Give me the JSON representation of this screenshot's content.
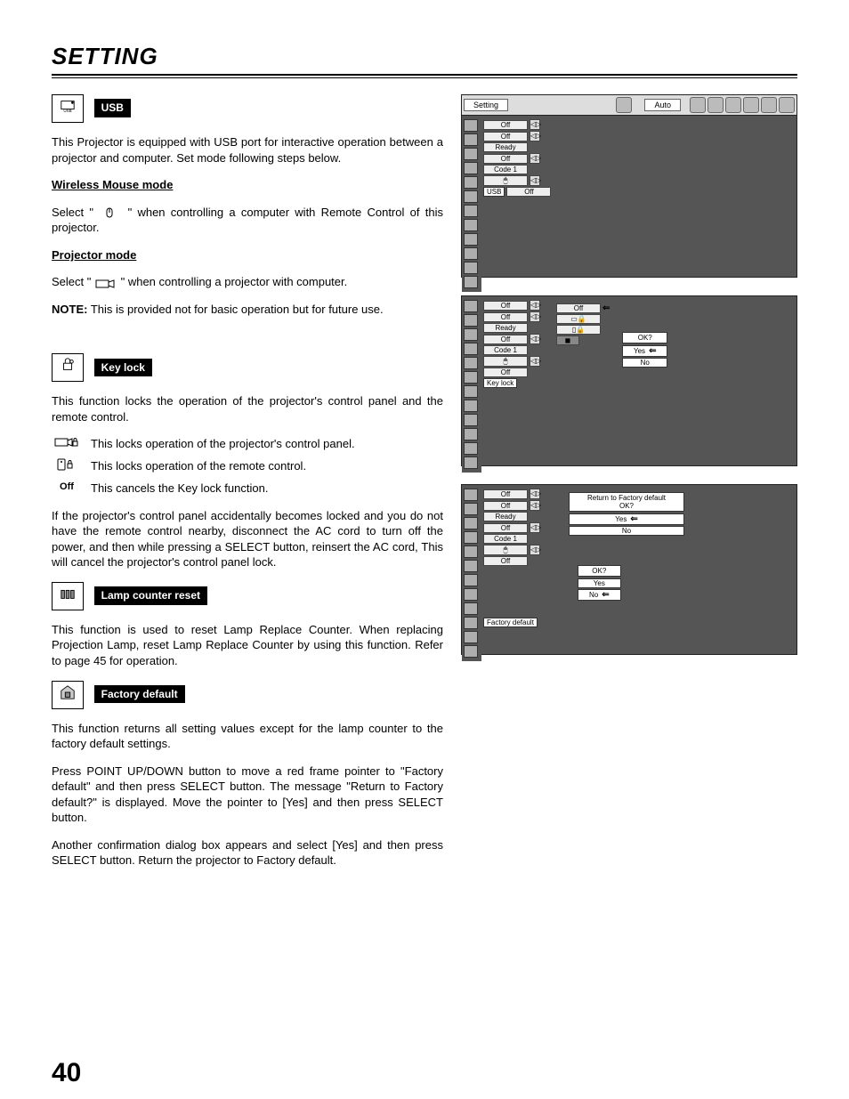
{
  "page_title": "SETTING",
  "page_number": "40",
  "usb": {
    "label": "USB",
    "intro": "This Projector is equipped with USB port for interactive operation between a projector and computer. Set mode following steps below.",
    "wireless_heading": "Wireless Mouse mode",
    "wireless_pre": "Select \"",
    "wireless_post": "\" when controlling a computer with Remote Control of this projector.",
    "projector_heading": "Projector mode",
    "projector_pre": "Select \"",
    "projector_post": "\" when controlling a projector with computer.",
    "note_label": "NOTE:",
    "note_text": " This is provided not for basic operation but for future use."
  },
  "keylock": {
    "label": "Key lock",
    "intro": "This function locks the operation of the projector's control panel and the remote control.",
    "lock_panel": "This locks operation of the projector's control panel.",
    "lock_remote": "This locks operation of the remote control.",
    "off_label": "Off",
    "cancel": "This cancels the Key lock function.",
    "para": "If the projector's control panel accidentally becomes locked and you do not have the remote control nearby, disconnect the AC cord to turn off the power, and then while pressing a SELECT button, reinsert the AC cord, This will cancel the projector's control panel lock."
  },
  "lamp": {
    "label": "Lamp counter reset",
    "para": "This function is used to reset Lamp Replace Counter.  When replacing Projection Lamp, reset Lamp Replace Counter by using this function.  Refer to page 45 for operation."
  },
  "factory": {
    "label": "Factory default",
    "p1": "This function returns all setting values except for the lamp counter to the factory default settings.",
    "p2": "Press POINT UP/DOWN button to move a red frame pointer to \"Factory default\" and then press SELECT button.  The message \"Return to Factory default?\" is displayed.  Move the pointer to [Yes] and then press SELECT button.",
    "p3": "Another confirmation dialog box appears and select [Yes] and then press SELECT button. Return the projector to Factory default."
  },
  "osd1": {
    "setting": "Setting",
    "auto": "Auto",
    "rows": [
      "Off",
      "Off",
      "Ready",
      "Off",
      "Code 1"
    ],
    "usb_label": "USB",
    "usb_off": "Off"
  },
  "osd2": {
    "rows": [
      "Off",
      "Off",
      "Ready",
      "Off",
      "Code 1"
    ],
    "off6": "Off",
    "keylock_label": "Key lock",
    "popup_off": "Off",
    "ok": "OK?",
    "yes": "Yes",
    "no": "No"
  },
  "osd3": {
    "rows": [
      "Off",
      "Off",
      "Ready",
      "Off",
      "Code 1"
    ],
    "off6": "Off",
    "factory_label": "Factory default",
    "msg1": "Return to Factory default",
    "msg2": "OK?",
    "yes": "Yes",
    "no": "No",
    "ok": "OK?"
  }
}
